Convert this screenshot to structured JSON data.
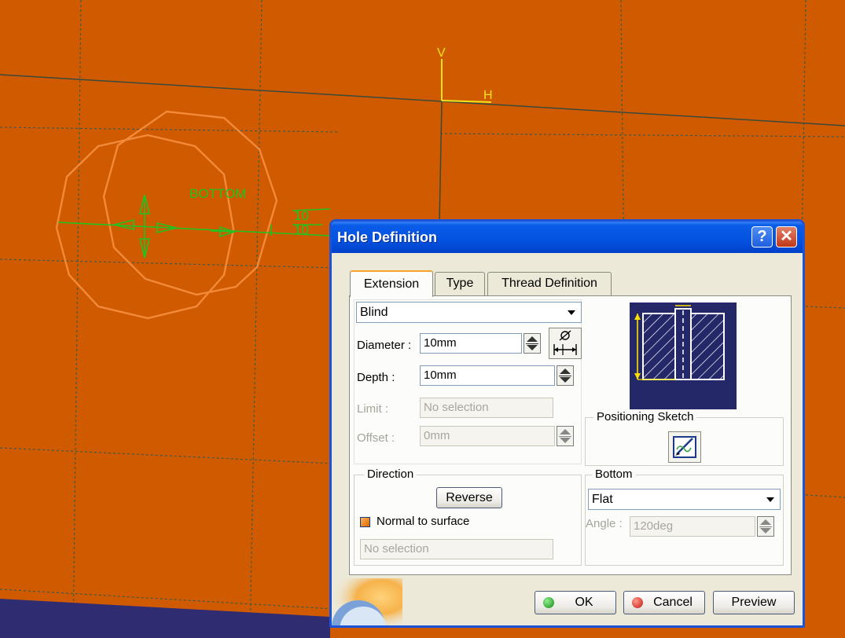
{
  "viewport": {
    "background_color": "#d05a00",
    "grid_color": "#3d5a4a",
    "sketch_color": "#22c222",
    "geometry_color": "#f28a3a",
    "axis_color": "#f2e21a",
    "sketch_label": "BOTTOM",
    "dimension_text_1": "10",
    "dimension_text_2": "10",
    "axis_v_label": "V",
    "axis_h_label": "H"
  },
  "dialog": {
    "title": "Hole Definition",
    "help_label": "?",
    "close_label": "✕",
    "tabs": [
      {
        "label": "Extension",
        "active": true
      },
      {
        "label": "Type",
        "active": false
      },
      {
        "label": "Thread Definition",
        "active": false
      }
    ],
    "extension": {
      "limit_type": "Blind",
      "diameter_label": "Diameter :",
      "diameter_value": "10mm",
      "depth_label": "Depth :",
      "depth_value": "10mm",
      "limit_label": "Limit :",
      "limit_value": "No selection",
      "offset_label": "Offset :",
      "offset_value": "0mm",
      "positioning_sketch_label": "Positioning Sketch",
      "direction": {
        "title": "Direction",
        "reverse_label": "Reverse",
        "normal_label": "Normal to surface",
        "normal_checked": true,
        "selection_value": "No selection"
      },
      "bottom": {
        "title": "Bottom",
        "type_value": "Flat",
        "angle_label": "Angle :",
        "angle_value": "120deg"
      }
    },
    "buttons": {
      "ok": "OK",
      "cancel": "Cancel",
      "preview": "Preview"
    },
    "icons": {
      "diameter_tool": "diameter-dimension-icon",
      "sketcher": "sketcher-icon",
      "preview_image": "blind-hole-preview-icon"
    }
  }
}
